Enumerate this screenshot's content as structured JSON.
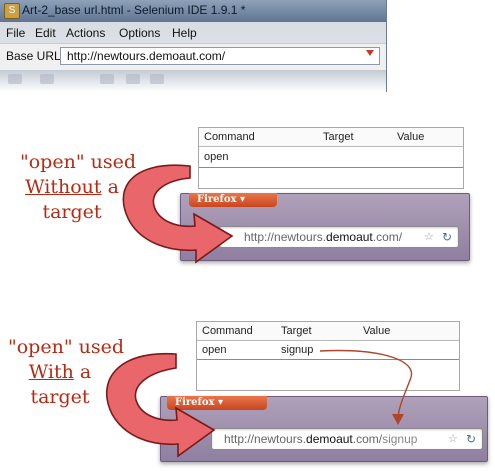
{
  "ide": {
    "title": "Art-2_base url.html - Selenium IDE 1.9.1 *",
    "menus": [
      "File",
      "Edit",
      "Actions",
      "Options",
      "Help"
    ],
    "base_url_label": "Base URL",
    "base_url_value": "http://newtours.demoaut.com/"
  },
  "example1": {
    "note_line1": "\"open\" used",
    "note_line2": "Without",
    "note_line2b": " a",
    "note_line3": "target",
    "table": {
      "headers": [
        "Command",
        "Target",
        "Value"
      ],
      "rows": [
        [
          "open",
          "",
          ""
        ]
      ]
    },
    "firefox_label": "Firefox",
    "url_prefix": "http://newtours.",
    "url_host": "demoaut",
    "url_suffix": ".com/",
    "url_path": ""
  },
  "example2": {
    "note_line1": "\"open\" used",
    "note_line2": "With",
    "note_line2b": " a",
    "note_line3": "target",
    "table": {
      "headers": [
        "Command",
        "Target",
        "Value"
      ],
      "rows": [
        [
          "open",
          "signup",
          ""
        ]
      ]
    },
    "firefox_label": "Firefox",
    "url_prefix": "http://newtours.",
    "url_host": "demoaut",
    "url_suffix": ".com/",
    "url_path": "signup"
  },
  "colors": {
    "arrow_fill": "#e9676a",
    "arrow_stroke": "#7a1a1a",
    "annotation_text": "#b62a14",
    "firefox_button": "#d8542c"
  }
}
